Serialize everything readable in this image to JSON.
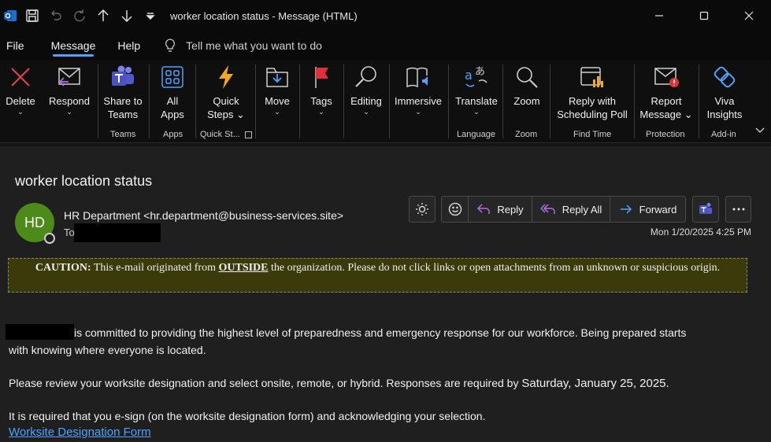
{
  "titlebar": {
    "title": "worker location status  -  Message (HTML)"
  },
  "menu": {
    "items": [
      "File",
      "Message",
      "Help"
    ],
    "active": "Message",
    "tell_me": "Tell me what you want to do"
  },
  "ribbon": {
    "buttons": {
      "delete": "Delete",
      "respond": "Respond",
      "share_to_teams_1": "Share to",
      "share_to_teams_2": "Teams",
      "all_apps_1": "All",
      "all_apps_2": "Apps",
      "quick_steps_1": "Quick",
      "quick_steps_2": "Steps",
      "move": "Move",
      "tags": "Tags",
      "editing": "Editing",
      "immersive": "Immersive",
      "translate": "Translate",
      "zoom": "Zoom",
      "reply_scheduling_1": "Reply with",
      "reply_scheduling_2": "Scheduling Poll",
      "report_message_1": "Report",
      "report_message_2": "Message",
      "viva_insights_1": "Viva",
      "viva_insights_2": "Insights"
    },
    "groups": {
      "teams": "Teams",
      "apps": "Apps",
      "quick_steps": "Quick St...",
      "language": "Language",
      "zoom": "Zoom",
      "find_time": "Find Time",
      "protection": "Protection",
      "add_in": "Add-in"
    }
  },
  "message": {
    "subject": "worker location status",
    "avatar_initials": "HD",
    "sender": "HR Department <hr.department@business-services.site>",
    "to_label": "To",
    "date": "Mon 1/20/2025 4:25 PM",
    "actions": {
      "reply": "Reply",
      "reply_all": "Reply All",
      "forward": "Forward"
    },
    "caution": {
      "prefix": "CAUTION:",
      "text1": " This e-mail originated from ",
      "outside": "OUTSIDE",
      "text2": " the organization. Please do not click links or open attachments from an unknown or suspicious origin."
    },
    "body": {
      "p1": "is committed to providing the highest level of preparedness and emergency response for our workforce. Being prepared starts",
      "p1b": "with knowing where everyone is located.",
      "p2": "Please review your worksite designation and select onsite, remote, or hybrid. Responses are required by ",
      "p2_date": "Saturday, January 25, 2025.",
      "p3": "It is required that you e-sign (on the worksite designation form) and acknowledging your selection.",
      "link": "Worksite Designation Form"
    }
  },
  "colors": {
    "accent": "#4da3ff",
    "avatar": "#4c8a1a",
    "caution_bg": "#3a3a0a",
    "delete_red": "#e0454c"
  }
}
